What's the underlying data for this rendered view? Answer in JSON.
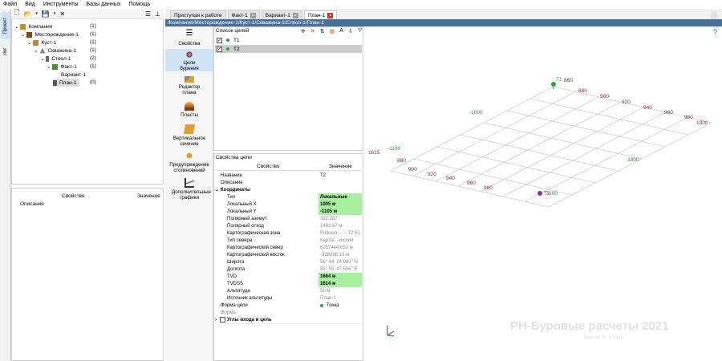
{
  "menu": [
    "Файл",
    "Вид",
    "Инструменты",
    "Базы данных",
    "Помощь"
  ],
  "vtabs": {
    "project": "Проект",
    "log": "Лог"
  },
  "tree": [
    {
      "label": "Компания",
      "count": "(1)"
    },
    {
      "label": "Месторождение-1",
      "count": "(1)"
    },
    {
      "label": "Куст-1",
      "count": "(1)"
    },
    {
      "label": "Скважина-1",
      "count": "(1)"
    },
    {
      "label": "Ствол-1",
      "count": "(2)"
    },
    {
      "label": "Факт-1",
      "count": "(1)"
    },
    {
      "label": "Вариант-1",
      "count": ""
    },
    {
      "label": "План-1",
      "count": "(0)"
    }
  ],
  "left_props": {
    "col_property": "Свойство",
    "col_value": "Значение",
    "row_description": "Описание"
  },
  "doc_tabs": [
    "Приступая к работе",
    "Факт-1",
    "Вариант-1",
    "План-1"
  ],
  "path": "/Компания/Месторождение-1/Куст-1/Скважина-1/Ствол-1/План-1",
  "side_tools": [
    "Свойства",
    "Цели бурения",
    "Редактор плана",
    "Пласты",
    "Вертикальное сечение",
    "Предупреждение столкновений",
    "Дополнительные графики"
  ],
  "targets": {
    "title": "Список целей",
    "items": [
      "T1",
      "T2"
    ]
  },
  "target_props": {
    "title": "Свойства цели",
    "col_property": "Свойство",
    "col_value": "Значение",
    "rows": [
      {
        "name": "Название",
        "value": "T2"
      },
      {
        "name": "Описание",
        "value": ""
      },
      {
        "name": "Координаты",
        "value": ""
      },
      {
        "name": "Тип",
        "value": "Локальные"
      },
      {
        "name": "Локальный X",
        "value": "1005 м"
      },
      {
        "name": "Локальный Y",
        "value": "-1105 м"
      },
      {
        "name": "Полярный азимут",
        "value": "312.287 °"
      },
      {
        "name": "Полярный отход",
        "value": "1493.67 м"
      },
      {
        "name": "Картографическая зона",
        "value": "Pulkovo ... – 72°E)"
      },
      {
        "name": "Тип севера",
        "value": "Картог...ческий"
      },
      {
        "name": "Картографический север",
        "value": "6257444.652 м"
      },
      {
        "name": "Картографический восток",
        "value": "-318298.13 м"
      },
      {
        "name": "Широта",
        "value": "55° 44' 24.982'' N"
      },
      {
        "name": "Долгота",
        "value": "55° 55' 47.556'' E"
      },
      {
        "name": "TVD",
        "value": "1664 м"
      },
      {
        "name": "TVDSS",
        "value": "1614 м"
      },
      {
        "name": "Альтитуда",
        "value": "50 м"
      },
      {
        "name": "Источник альтитуды",
        "value": "План-1"
      },
      {
        "name": "Форма цели",
        "value": "Точка"
      },
      {
        "name": "Форма",
        "value": ""
      },
      {
        "name": "Углы входа в цель",
        "value": ""
      }
    ]
  },
  "view3d": {
    "labels_right": [
      "880",
      "900",
      "920",
      "940",
      "960",
      "980",
      "1000"
    ],
    "labels_left": [
      "880",
      "900",
      "920",
      "940",
      "960",
      "980"
    ],
    "label_860": "860",
    "label_m1000": "-1000",
    "label_m1100": "-1100",
    "label_m1800": "-1800",
    "label_1100": "1100",
    "label_1615": "1615",
    "t1": "T1",
    "t2": "T2",
    "watermark": "РН-Буровые расчеты 2021",
    "version": "Версия от 30 мая"
  }
}
